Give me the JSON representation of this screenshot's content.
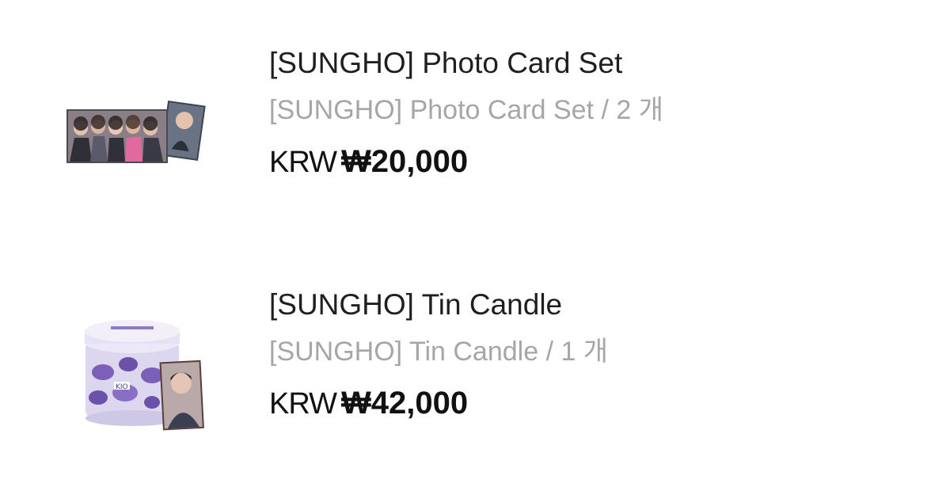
{
  "order_items": [
    {
      "title": "[SUNGHO] Photo Card Set",
      "option": "[SUNGHO] Photo Card Set / 2 개",
      "currency": "KRW",
      "price": "₩20,000",
      "thumbnail_icon": "photo-card-set-thumbnail"
    },
    {
      "title": "[SUNGHO] Tin Candle",
      "option": "[SUNGHO] Tin Candle / 1 개",
      "currency": "KRW",
      "price": "₩42,000",
      "thumbnail_icon": "tin-candle-thumbnail"
    }
  ],
  "colors": {
    "title": "#1f1f1f",
    "option": "#a6a6a6",
    "price": "#111111",
    "candle_accent": "#7b5fb8"
  }
}
